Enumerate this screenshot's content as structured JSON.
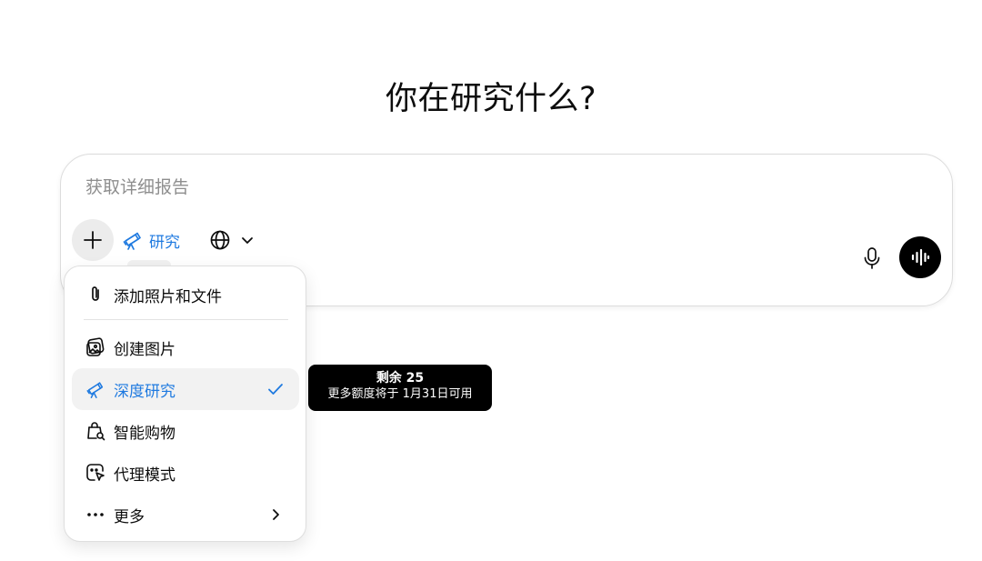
{
  "page_title": "你在研究什么?",
  "composer": {
    "placeholder": "获取详细报告",
    "research_tool_label": "研究",
    "add_icon": "plus-icon",
    "research_icon": "telescope-icon",
    "web_icon": "globe-icon",
    "mic_icon": "microphone-icon",
    "voice_icon": "voice-waveform-icon"
  },
  "menu": {
    "items": [
      {
        "label": "添加照片和文件",
        "icon": "paperclip-icon"
      },
      {
        "label": "创建图片",
        "icon": "image-create-icon"
      },
      {
        "label": "深度研究",
        "icon": "telescope-icon",
        "selected": true
      },
      {
        "label": "智能购物",
        "icon": "shopping-bag-icon"
      },
      {
        "label": "代理模式",
        "icon": "agent-cursor-icon"
      },
      {
        "label": "更多",
        "icon": "more-dots-icon"
      }
    ]
  },
  "tooltip": {
    "title": "剩余 25",
    "subtitle": "更多额度将于 1月31日可用"
  },
  "colors": {
    "accent": "#1f7ae0",
    "text": "#0d0d0d",
    "placeholder": "#8e8e8e",
    "tooltip_bg": "#000000"
  }
}
